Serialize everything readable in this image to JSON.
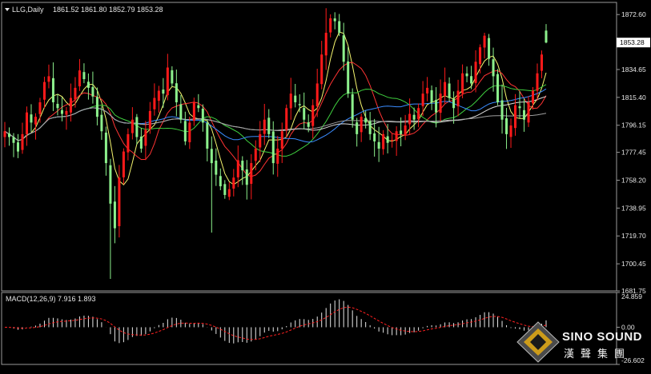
{
  "header": {
    "symbol": "LLG,Daily",
    "open": "1861.52",
    "high": "1861.80",
    "low": "1852.79",
    "close": "1853.28"
  },
  "macd": {
    "label": "MACD(12,26,9) 7.916 1.893",
    "ticks": [
      "24.859",
      "0.00",
      "-26.602"
    ],
    "tick_values": [
      24.859,
      0.0,
      -26.602
    ],
    "ylim": [
      -26.602,
      24.859
    ]
  },
  "logo": {
    "english": "SINO SOUND",
    "chinese": "漢聲集團"
  },
  "chart_data": {
    "type": "candlestick",
    "title": "LLG,Daily",
    "price_ticks": [
      "1872.60",
      "1853.28",
      "1834.65",
      "1815.40",
      "1796.15",
      "1777.45",
      "1758.20",
      "1738.95",
      "1719.70",
      "1700.45",
      "1681.75"
    ],
    "price_tick_values": [
      1872.6,
      1853.28,
      1834.65,
      1815.4,
      1796.15,
      1777.45,
      1758.2,
      1738.95,
      1719.7,
      1700.45,
      1681.75
    ],
    "current_price": 1853.28,
    "ylim": [
      1681.75,
      1881.0
    ],
    "colors": {
      "up": "#ff1a1a",
      "down": "#8cf08c",
      "background": "#000000",
      "macd_hist": "#e8e8e8",
      "macd_signal": "#ff2020",
      "ma_yellow": "#f5f56e",
      "ma_red": "#ff3333",
      "ma_green": "#3fcf3f",
      "ma_blue": "#3a8cff",
      "ma_white": "#dcdcdc",
      "ma_grey": "#a0a0a0"
    },
    "closes": [
      1792,
      1788,
      1784,
      1778,
      1790,
      1805,
      1798,
      1802,
      1812,
      1826,
      1830,
      1812,
      1808,
      1804,
      1806,
      1815,
      1822,
      1834,
      1828,
      1822,
      1816,
      1802,
      1792,
      1770,
      1742,
      1725,
      1760,
      1778,
      1790,
      1800,
      1788,
      1780,
      1793,
      1806,
      1815,
      1820,
      1818,
      1836,
      1825,
      1812,
      1800,
      1785,
      1798,
      1812,
      1808,
      1798,
      1780,
      1770,
      1762,
      1754,
      1748,
      1752,
      1760,
      1772,
      1765,
      1755,
      1770,
      1780,
      1790,
      1800,
      1790,
      1770,
      1780,
      1792,
      1808,
      1818,
      1812,
      1810,
      1800,
      1795,
      1810,
      1825,
      1845,
      1860,
      1870,
      1868,
      1860,
      1840,
      1818,
      1800,
      1790,
      1802,
      1798,
      1790,
      1785,
      1780,
      1790,
      1784,
      1786,
      1792,
      1790,
      1796,
      1804,
      1800,
      1808,
      1818,
      1822,
      1812,
      1805,
      1818,
      1826,
      1815,
      1808,
      1820,
      1832,
      1830,
      1825,
      1840,
      1850,
      1858,
      1842,
      1830,
      1812,
      1800,
      1790,
      1796,
      1810,
      1808,
      1800,
      1812,
      1820,
      1832,
      1845,
      1853.28
    ]
  }
}
